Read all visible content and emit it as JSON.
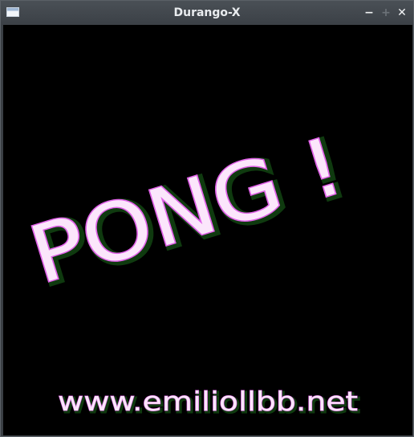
{
  "window": {
    "title": "Durango-X",
    "minimize_label": "−",
    "maximize_label": "+",
    "close_label": "✕"
  },
  "screen": {
    "logo": "PONG !",
    "url": "www.emiliollbb.net"
  },
  "colors": {
    "screen_bg": "#000000",
    "text_fill": "#fbe6fb",
    "text_outline": "#e060e8",
    "text_shadow": "#0f3a0f",
    "titlebar": "#3b4046"
  }
}
